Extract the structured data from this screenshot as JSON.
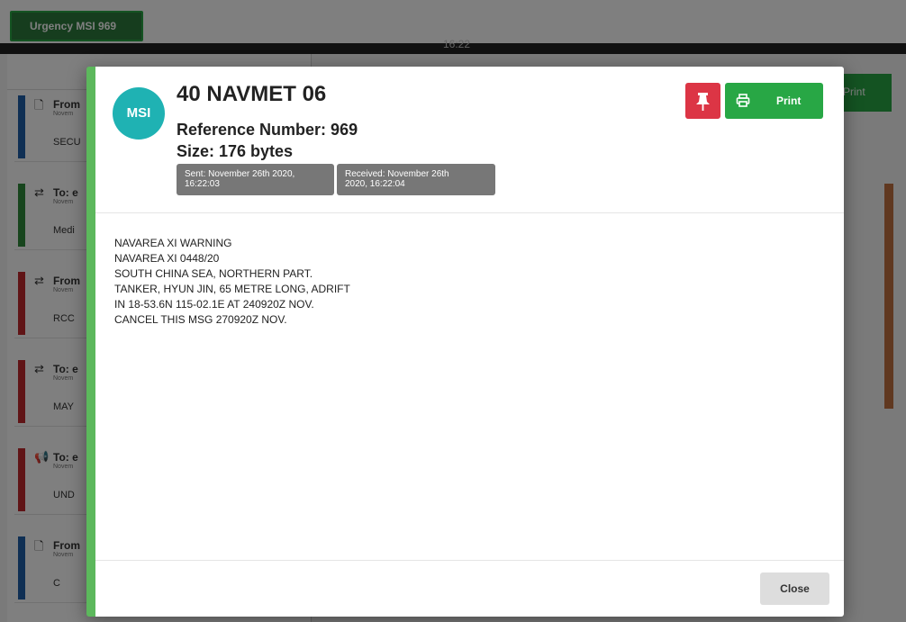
{
  "background": {
    "urgency_button": "Urgency MSI 969",
    "clock": "16:22",
    "right_print_label": "Print",
    "cards": [
      {
        "icon": "file-icon",
        "title": "From",
        "sub": "Novem",
        "body": "SECU",
        "color": "#1f5fa8"
      },
      {
        "icon": "exchange-icon",
        "title": "To: e",
        "sub": "Novem",
        "body": "Medi",
        "color": "#2e8b3a"
      },
      {
        "icon": "exchange-icon",
        "title": "From",
        "sub": "Novem",
        "body": "RCC",
        "color": "#c0282d"
      },
      {
        "icon": "exchange-icon",
        "title": "To: e",
        "sub": "Novem",
        "body": "MAY",
        "color": "#c0282d"
      },
      {
        "icon": "megaphone-icon",
        "title": "To: e",
        "sub": "Novem",
        "body": "UND",
        "color": "#c0282d"
      },
      {
        "icon": "file-icon",
        "title": "From",
        "sub": "Novem",
        "body": "C",
        "color": "#1f5fa8"
      }
    ]
  },
  "modal": {
    "avatar": "MSI",
    "title": "40 NAVMET 06",
    "reference": "Reference Number: 969",
    "size": "Size: 176 bytes",
    "sent_line1": "Sent: November 26th 2020,",
    "sent_line2": "16:22:03",
    "received_line1": "Received: November 26th",
    "received_line2": "2020, 16:22:04",
    "pin_icon": "pin-icon",
    "print_icon": "printer-icon",
    "print_label": "Print",
    "close_label": "Close",
    "accent_color": "#5cb85c",
    "message_lines": [
      "NAVAREA XI WARNING",
      "NAVAREA XI 0448/20",
      "SOUTH CHINA SEA, NORTHERN PART.",
      "TANKER, HYUN JIN, 65 METRE LONG, ADRIFT",
      "IN 18-53.6N 115-02.1E AT 240920Z NOV.",
      "CANCEL THIS MSG 270920Z NOV."
    ]
  }
}
